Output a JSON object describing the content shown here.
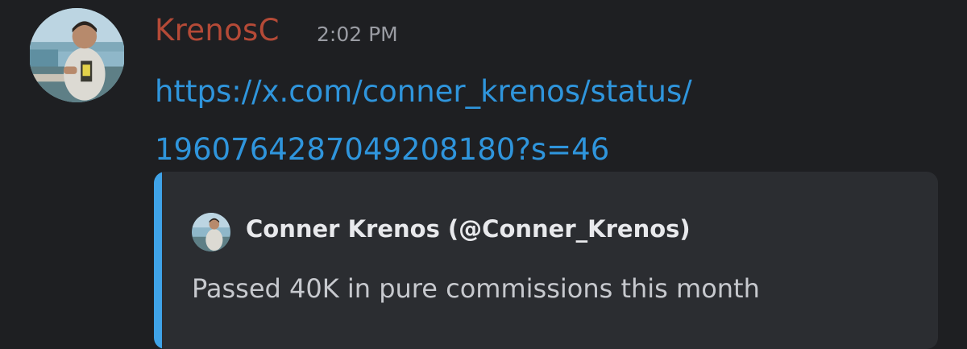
{
  "message": {
    "author": "KrenosC",
    "timestamp": "2:02 PM",
    "link_line1": "https://x.com/conner_krenos/status/",
    "link_line2": "1960764287049208180?s=46"
  },
  "embed": {
    "author": "Conner Krenos (@Conner_Krenos)",
    "description": "Passed 40K in pure commissions this month"
  },
  "colors": {
    "background": "#1e1f22",
    "author": "#b54a37",
    "link": "#2f95dc",
    "embed_bg": "#2b2d31",
    "embed_bar": "#3fa3e8"
  }
}
